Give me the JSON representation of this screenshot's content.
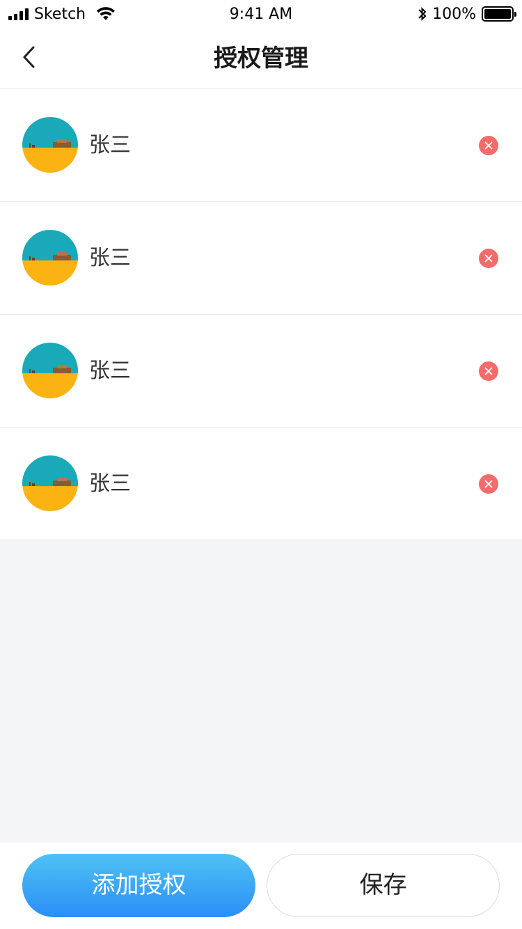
{
  "status_bar": {
    "carrier": "Sketch",
    "time": "9:41 AM",
    "battery_percent": "100%"
  },
  "header": {
    "title": "授权管理",
    "back_icon": "chevron-left-icon"
  },
  "users": [
    {
      "name": "张三",
      "avatar_icon": "user-avatar",
      "remove_icon": "close-circle-icon"
    },
    {
      "name": "张三",
      "avatar_icon": "user-avatar",
      "remove_icon": "close-circle-icon"
    },
    {
      "name": "张三",
      "avatar_icon": "user-avatar",
      "remove_icon": "close-circle-icon"
    },
    {
      "name": "张三",
      "avatar_icon": "user-avatar",
      "remove_icon": "close-circle-icon"
    }
  ],
  "footer": {
    "add_label": "添加授权",
    "save_label": "保存"
  },
  "colors": {
    "accent_gradient_top": "#4fc2f5",
    "accent_gradient_bottom": "#2a8ef6",
    "remove_red": "#f36b6b",
    "page_background": "#f4f5f7"
  }
}
